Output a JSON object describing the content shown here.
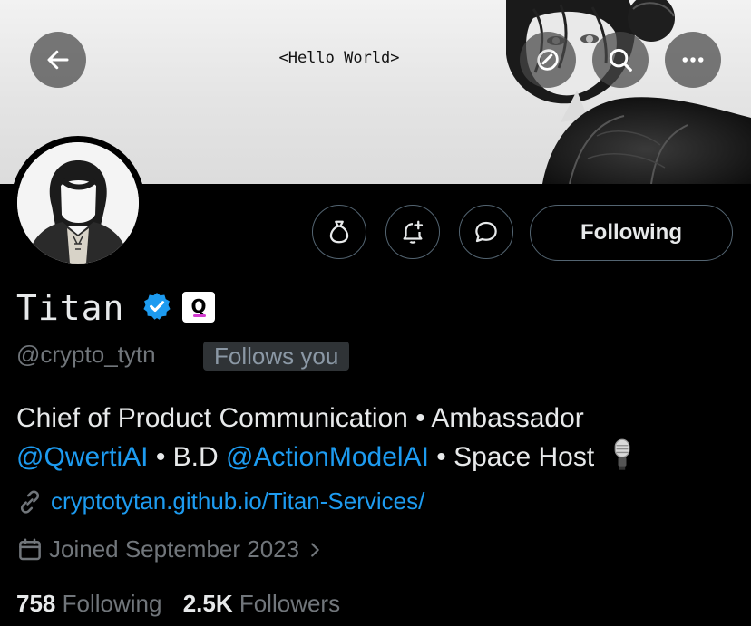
{
  "header": {
    "banner_text": "<Hello World>"
  },
  "profile": {
    "display_name": "Titan",
    "affiliate_badge_label": "Q",
    "handle": "@crypto_tytn",
    "follows_you_label": "Follows you",
    "bio": {
      "line1": "Chief of Product Communication • Ambassador",
      "mention1": "@QwertiAI",
      "sep1": " • B.D ",
      "mention2": "@ActionModelAI",
      "tail": " • Space Host"
    },
    "website": "cryptotytan.github.io/Titan-Services/",
    "joined": "Joined September 2023",
    "following_count": "758",
    "following_label": "Following",
    "followers_count": "2.5K",
    "followers_label": "Followers"
  },
  "actions": {
    "follow_button_label": "Following"
  },
  "icons": {
    "back": "arrow-left-icon",
    "grok": "grok-icon",
    "search": "search-icon",
    "more": "more-icon",
    "tip": "money-bag-icon",
    "notify": "bell-plus-icon",
    "message": "message-icon",
    "verified": "verified-badge-icon",
    "link": "link-icon",
    "calendar": "calendar-icon",
    "chevron": "chevron-right-icon",
    "microphone": "microphone-emoji"
  },
  "colors": {
    "accent": "#1d9bf0",
    "muted": "#71767b",
    "background": "#000000",
    "text": "#e7e9ea"
  }
}
